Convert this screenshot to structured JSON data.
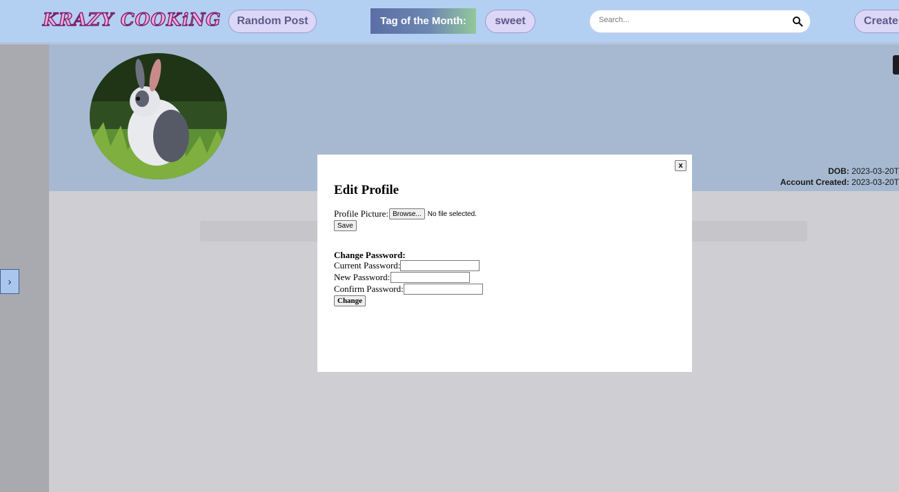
{
  "nav": {
    "logo": "KRAZY COOKiNG",
    "random_post": "Random Post",
    "tag_of_month_label": "Tag of the Month:",
    "tag_of_month_value": "sweet",
    "search_placeholder": "Search...",
    "create_label": "Create"
  },
  "sidebar": {
    "toggle_label": "›"
  },
  "profile": {
    "dob_label": "DOB:",
    "dob_value": "2023-03-20T",
    "created_label": "Account Created:",
    "created_value": "2023-03-20T"
  },
  "modal": {
    "close_label": "x",
    "title": "Edit Profile",
    "picture_label": "Profile Picture:",
    "browse_label": "Browse...",
    "no_file": "No file selected.",
    "save_label": "Save",
    "change_password_heading": "Change Password:",
    "current_password_label": "Current Password:",
    "new_password_label": "New Password:",
    "confirm_password_label": "Confirm Password:",
    "change_label": "Change"
  }
}
